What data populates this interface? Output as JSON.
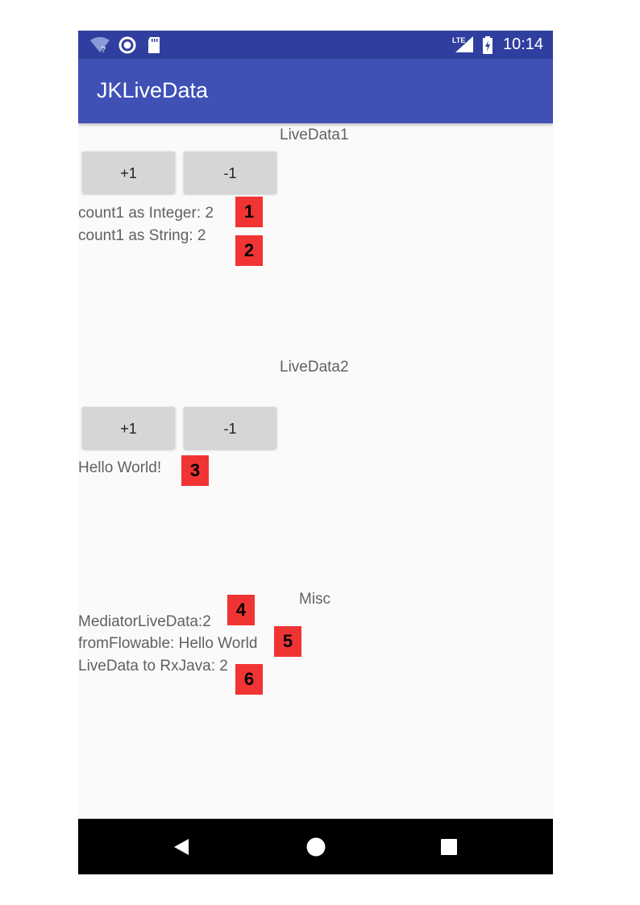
{
  "status_bar": {
    "time": "10:14",
    "left_icons": [
      "wifi-icon",
      "sync-circle-icon",
      "sd-card-icon"
    ],
    "right_icons": [
      "lte-signal-icon",
      "battery-charging-icon"
    ],
    "lte_label": "LTE"
  },
  "app_bar": {
    "title": "JKLiveData"
  },
  "livedata1": {
    "title": "LiveData1",
    "plus_label": "+1",
    "minus_label": "-1",
    "count_integer": "count1 as Integer: 2",
    "count_string": "count1 as String: 2"
  },
  "livedata2": {
    "title": "LiveData2",
    "plus_label": "+1",
    "minus_label": "-1",
    "text": "Hello World!"
  },
  "misc": {
    "title": "Misc",
    "mediator": "MediatorLiveData:2",
    "from_flowable": "fromFlowable: Hello World",
    "to_rxjava": "LiveData to RxJava: 2"
  },
  "markers": [
    "1",
    "2",
    "3",
    "4",
    "5",
    "6"
  ],
  "nav_bar": {
    "icons": [
      "back-icon",
      "home-icon",
      "recents-icon"
    ]
  },
  "colors": {
    "status_bar": "#303f9f",
    "app_bar": "#3f51b5",
    "marker": "#f03434",
    "button": "#d6d6d6"
  }
}
